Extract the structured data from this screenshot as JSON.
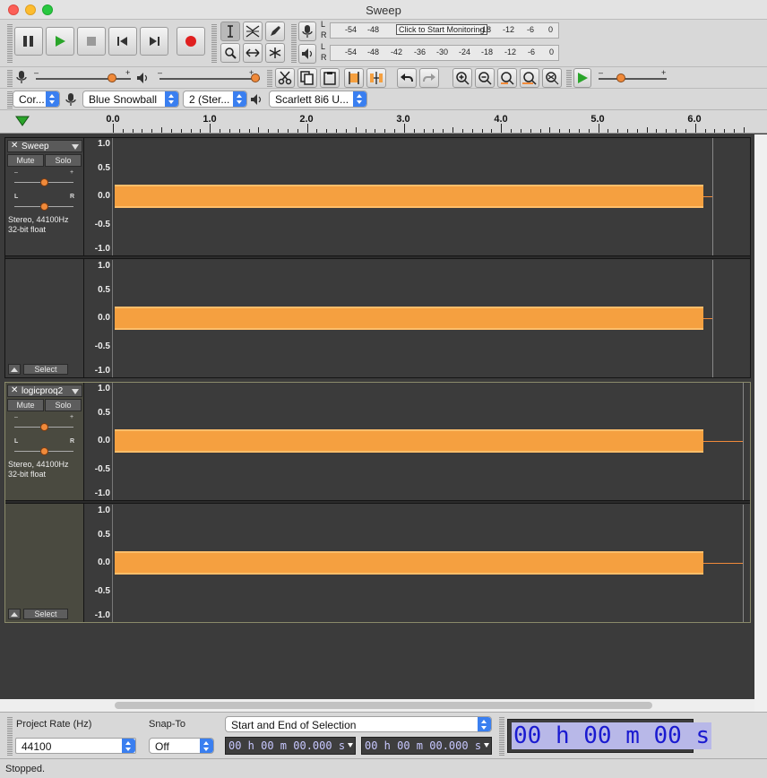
{
  "window": {
    "title": "Sweep"
  },
  "meters": {
    "record_label_L": "L",
    "record_label_R": "R",
    "playback_label_L": "L",
    "playback_label_R": "R",
    "scale": [
      "-54",
      "-48",
      "-42",
      "-36",
      "-30",
      "-24",
      "-18",
      "-12",
      "-6",
      "0"
    ],
    "record_scale_visible": [
      "-54",
      "-48",
      "-18",
      "-12",
      "-6",
      "0"
    ],
    "monitor_prompt": "Click to Start Monitoring"
  },
  "mixer": {
    "minus": "–",
    "plus": "+"
  },
  "play_at_speed": {
    "minus": "–",
    "plus": "+"
  },
  "devices": {
    "host": "Cor...",
    "recording_device": "Blue Snowball",
    "channels": "2 (Ster...",
    "playback_device": "Scarlett 8i6 U..."
  },
  "ruler": {
    "labels": [
      "0.0",
      "1.0",
      "2.0",
      "3.0",
      "4.0",
      "5.0",
      "6.0"
    ]
  },
  "tracks": [
    {
      "name": "Sweep",
      "mute": "Mute",
      "solo": "Solo",
      "gain_minus": "–",
      "gain_plus": "+",
      "pan_left": "L",
      "pan_right": "R",
      "format_line1": "Stereo, 44100Hz",
      "format_line2": "32-bit float",
      "select": "Select",
      "selected": false
    },
    {
      "name": "logicproq2",
      "mute": "Mute",
      "solo": "Solo",
      "gain_minus": "–",
      "gain_plus": "+",
      "pan_left": "L",
      "pan_right": "R",
      "format_line1": "Stereo, 44100Hz",
      "format_line2": "32-bit float",
      "select": "Select",
      "selected": true
    }
  ],
  "vruler_labels": [
    "1.0",
    "0.5",
    "0.0",
    "-0.5",
    "-1.0"
  ],
  "selection_toolbar": {
    "project_rate_label": "Project Rate (Hz)",
    "project_rate_value": "44100",
    "snap_to_label": "Snap-To",
    "snap_to_value": "Off",
    "selection_mode": "Start and End of Selection",
    "start_time": "00 h 00 m 00.000 s",
    "end_time": "00 h 00 m 00.000 s",
    "audio_position": "00 h 00 m 00 s"
  },
  "status": {
    "text": "Stopped."
  },
  "colors": {
    "waveform": "#f5a040",
    "accent": "#3a7ff0",
    "knob": "#f08a3a"
  }
}
